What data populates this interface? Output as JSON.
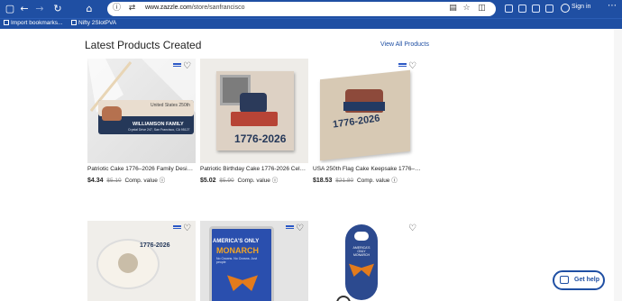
{
  "browser": {
    "url_host": "www.zazzle.com",
    "url_path": "/store/sanfrancisco",
    "signin_label": "Sign in",
    "bookmarks": [
      {
        "label": "Import bookmarks..."
      },
      {
        "label": "Nifty 2SlotPVA"
      }
    ]
  },
  "section": {
    "title": "Latest Products Created",
    "view_all": "View All Products"
  },
  "products": [
    {
      "title": "Patriotic Cake 1776–2026 Family Design ...",
      "price": "$4.34",
      "old_price": "$5.10",
      "comp": "Comp. value"
    },
    {
      "title": "Patriotic Birthday Cake 1776-2026 Celebr...",
      "price": "$5.02",
      "old_price": "$5.90",
      "comp": "Comp. value"
    },
    {
      "title": "USA 250th Flag Cake Keepsake 1776–20...",
      "price": "$18.53",
      "old_price": "$21.80",
      "comp": "Comp. value"
    }
  ],
  "images": {
    "label_line1": "United States 250th",
    "label_name": "WILLIAMSON FAMILY",
    "label_addr": "Crystal Drive 247, San Francisco, CA 95127",
    "magnet_years": "1776-2026",
    "tile_years": "1776-2026",
    "roll_years": "1776-2026",
    "lighter_top": "AMERICA'S ONLY",
    "lighter_big": "MONARCH",
    "lighter_small": "No Crowns. No Crowns. Just people",
    "opener_text": "AMERICA'S ONLY MONARCH"
  },
  "help": {
    "label": "Get help"
  },
  "colors": {
    "brand": "#1f4fa3",
    "accent": "#2c59c6"
  }
}
